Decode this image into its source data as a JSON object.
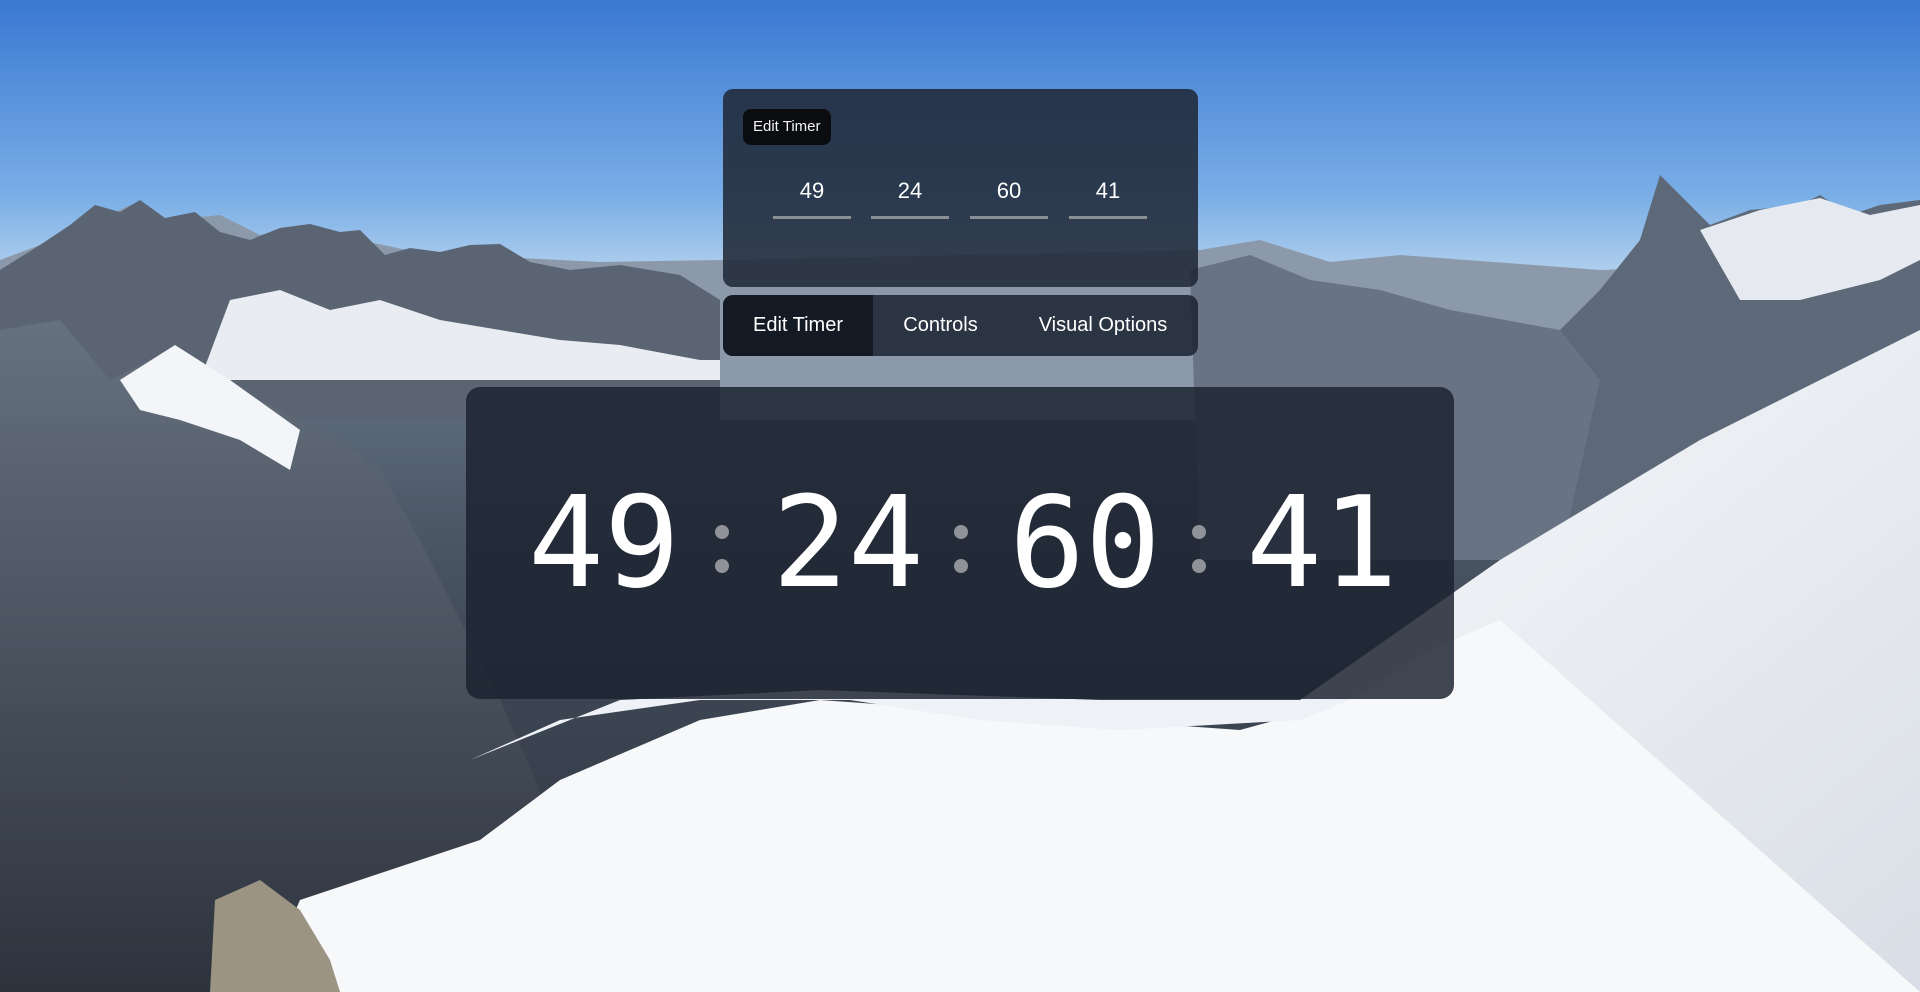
{
  "background": {
    "description_icon": "mountain-landscape",
    "sky_color": "#4a8ad9",
    "snow_color": "#f2f4f7",
    "rock_color": "#3d4552"
  },
  "edit_timer": {
    "badge_label": "Edit Timer",
    "fields": [
      "49",
      "24",
      "60",
      "41"
    ]
  },
  "tabs": [
    {
      "label": "Edit Timer",
      "active": true
    },
    {
      "label": "Controls",
      "active": false
    },
    {
      "label": "Visual Options",
      "active": false
    }
  ],
  "timer": {
    "digits": [
      "49",
      "24",
      "60",
      "41"
    ]
  },
  "colors": {
    "panel": "#1e2634",
    "active_tab": "#141a24",
    "text": "#ffffff",
    "colon": "#8f9399"
  }
}
